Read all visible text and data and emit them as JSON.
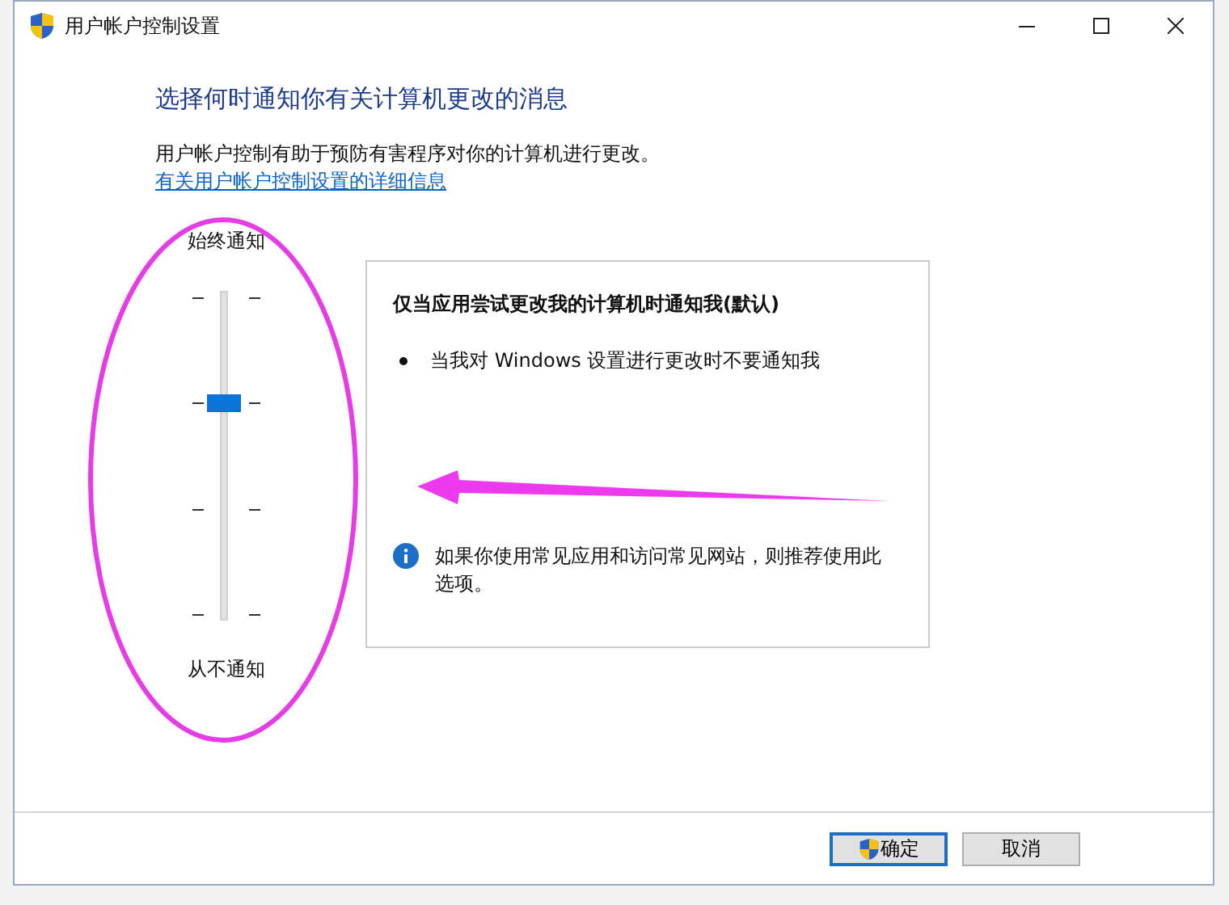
{
  "window": {
    "title": "用户帐户控制设置"
  },
  "heading": "选择何时通知你有关计算机更改的消息",
  "description": "用户帐户控制有助于预防有害程序对你的计算机进行更改。",
  "link": "有关用户帐户控制设置的详细信息",
  "slider": {
    "top_label": "始终通知",
    "bottom_label": "从不通知",
    "level": 0.6667
  },
  "panel": {
    "title": "仅当应用尝试更改我的计算机时通知我(默认)",
    "bullets": [
      "当我对 Windows 设置进行更改时不要通知我"
    ],
    "note": "如果你使用常见应用和访问常见网站，则推荐使用此选项。"
  },
  "buttons": [
    {
      "label": "确定",
      "kind": "shield",
      "default": true
    },
    {
      "label": "取消",
      "kind": "plain",
      "default": false
    }
  ]
}
